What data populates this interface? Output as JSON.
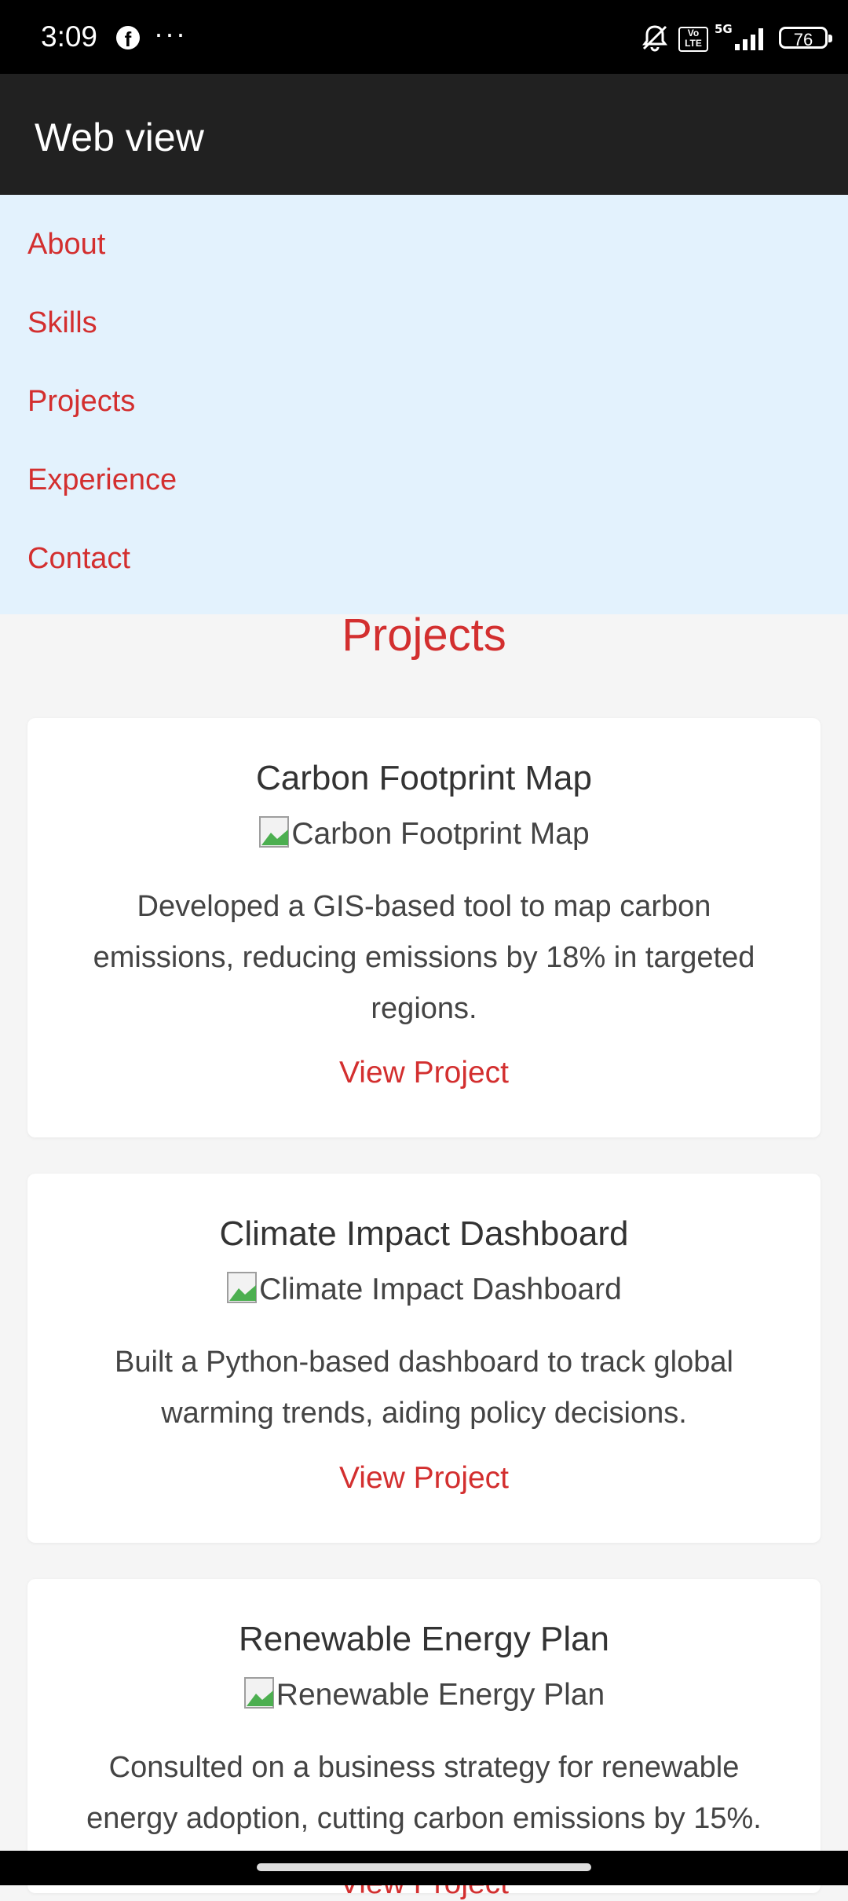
{
  "status_bar": {
    "time": "3:09",
    "more": "···",
    "battery": "76",
    "icons": [
      "facebook-icon",
      "more-icon",
      "mute-bell-icon",
      "volte-icon",
      "5g-signal-icon",
      "battery-icon"
    ]
  },
  "app_bar": {
    "title": "Web view"
  },
  "nav": {
    "items": [
      {
        "label": "About"
      },
      {
        "label": "Skills"
      },
      {
        "label": "Projects"
      },
      {
        "label": "Experience"
      },
      {
        "label": "Contact"
      }
    ]
  },
  "section": {
    "title": "Projects"
  },
  "projects": [
    {
      "title": "Carbon Footprint Map",
      "image_alt": "Carbon Footprint Map",
      "description": "Developed a GIS-based tool to map carbon emissions, reducing emissions by 18% in targeted regions.",
      "link": "View Project"
    },
    {
      "title": "Climate Impact Dashboard",
      "image_alt": "Climate Impact Dashboard",
      "description": "Built a Python-based dashboard to track global warming trends, aiding policy decisions.",
      "link": "View Project"
    },
    {
      "title": "Renewable Energy Plan",
      "image_alt": "Renewable Energy Plan",
      "description": "Consulted on a business strategy for renewable energy adoption, cutting carbon emissions by 15%.",
      "link": "View Project"
    }
  ],
  "colors": {
    "accent": "#d32f2f",
    "app_bar": "#212121",
    "nav_background": "#e3f2fd",
    "page_background": "#f5f5f5"
  }
}
